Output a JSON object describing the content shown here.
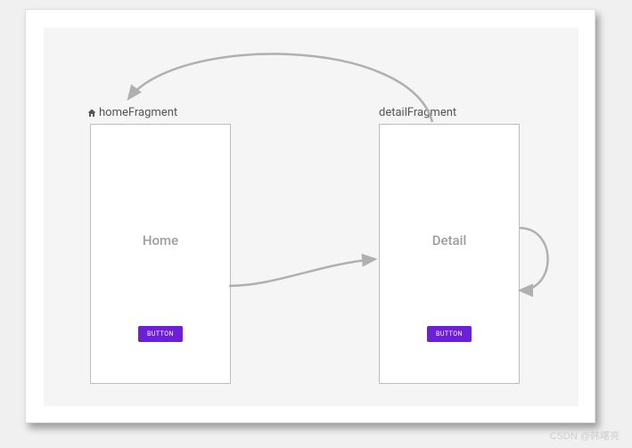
{
  "homeFragment": {
    "label": "homeFragment",
    "text": "Home",
    "button": "BUTTON"
  },
  "detailFragment": {
    "label": "detailFragment",
    "text": "Detail",
    "button": "BUTTON"
  },
  "watermark": "CSDN @韩曙亮",
  "arrows": {
    "home_to_detail": true,
    "detail_to_home_curve": true,
    "detail_self_loop": true
  }
}
